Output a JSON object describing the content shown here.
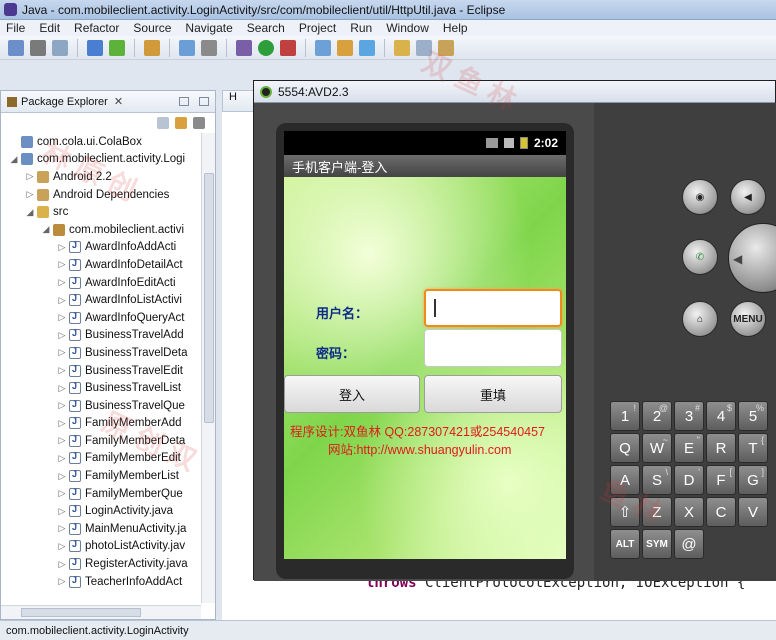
{
  "window": {
    "title": "Java - com.mobileclient.activity.LoginActivity/src/com/mobileclient/util/HttpUtil.java - Eclipse"
  },
  "menu": [
    "File",
    "Edit",
    "Refactor",
    "Source",
    "Navigate",
    "Search",
    "Project",
    "Run",
    "Window",
    "Help"
  ],
  "package_explorer": {
    "tab_label": "Package Explorer",
    "tree": [
      {
        "label": "com.cola.ui.ColaBox",
        "indent": 1,
        "icon": "project-icon"
      },
      {
        "label": "com.mobileclient.activity.Logi",
        "indent": 1,
        "icon": "project-icon",
        "expanded": true
      },
      {
        "label": "Android 2.2",
        "indent": 2,
        "icon": "library-icon"
      },
      {
        "label": "Android Dependencies",
        "indent": 2,
        "icon": "library-icon"
      },
      {
        "label": "src",
        "indent": 2,
        "icon": "source-folder-icon",
        "expanded": true
      },
      {
        "label": "com.mobileclient.activi",
        "indent": 3,
        "icon": "package-icon",
        "expanded": true
      },
      {
        "label": "AwardInfoAddActi",
        "indent": 4,
        "icon": "java-file-icon"
      },
      {
        "label": "AwardInfoDetailAct",
        "indent": 4,
        "icon": "java-file-icon"
      },
      {
        "label": "AwardInfoEditActi",
        "indent": 4,
        "icon": "java-file-icon"
      },
      {
        "label": "AwardInfoListActivi",
        "indent": 4,
        "icon": "java-file-icon"
      },
      {
        "label": "AwardInfoQueryAct",
        "indent": 4,
        "icon": "java-file-icon"
      },
      {
        "label": "BusinessTravelAdd",
        "indent": 4,
        "icon": "java-file-icon"
      },
      {
        "label": "BusinessTravelDeta",
        "indent": 4,
        "icon": "java-file-icon"
      },
      {
        "label": "BusinessTravelEdit",
        "indent": 4,
        "icon": "java-file-icon"
      },
      {
        "label": "BusinessTravelList",
        "indent": 4,
        "icon": "java-file-icon"
      },
      {
        "label": "BusinessTravelQue",
        "indent": 4,
        "icon": "java-file-icon"
      },
      {
        "label": "FamilyMemberAdd",
        "indent": 4,
        "icon": "java-file-icon"
      },
      {
        "label": "FamilyMemberDeta",
        "indent": 4,
        "icon": "java-file-icon"
      },
      {
        "label": "FamilyMemberEdit",
        "indent": 4,
        "icon": "java-file-icon"
      },
      {
        "label": "FamilyMemberList",
        "indent": 4,
        "icon": "java-file-icon"
      },
      {
        "label": "FamilyMemberQue",
        "indent": 4,
        "icon": "java-file-icon"
      },
      {
        "label": "LoginActivity.java",
        "indent": 4,
        "icon": "java-file-icon"
      },
      {
        "label": "MainMenuActivity.ja",
        "indent": 4,
        "icon": "java-file-icon"
      },
      {
        "label": "photoListActivity.jav",
        "indent": 4,
        "icon": "java-file-icon"
      },
      {
        "label": "RegisterActivity.java",
        "indent": 4,
        "icon": "java-file-icon"
      },
      {
        "label": "TeacherInfoAddAct",
        "indent": 4,
        "icon": "java-file-icon"
      }
    ]
  },
  "editor": {
    "tab_label": "H",
    "code_keyword": "throws",
    "code_rest": " ClientProtocolException, IOException {"
  },
  "status_bar": {
    "text": "com.mobileclient.activity.LoginActivity"
  },
  "emulator": {
    "title": "5554:AVD2.3",
    "clock": "2:02",
    "app_title": "手机客户端-登入",
    "username_label": "用户名：",
    "password_label": "密码：",
    "login_button": "登入",
    "reset_button": "重填",
    "credit_line": "程序设计:双鱼林    QQ:287307421或254540457",
    "website_line": "网站:http://www.shuangyulin.com",
    "menu_key": "MENU",
    "keyboard_rows": [
      [
        {
          "k": "1",
          "s": "!"
        },
        {
          "k": "2",
          "s": "@"
        },
        {
          "k": "3",
          "s": "#"
        },
        {
          "k": "4",
          "s": "$"
        },
        {
          "k": "5",
          "s": "%"
        }
      ],
      [
        {
          "k": "Q",
          "s": ""
        },
        {
          "k": "W",
          "s": "~"
        },
        {
          "k": "E",
          "s": "\""
        },
        {
          "k": "R",
          "s": ""
        },
        {
          "k": "T",
          "s": "{"
        }
      ],
      [
        {
          "k": "A",
          "s": ""
        },
        {
          "k": "S",
          "s": "\\"
        },
        {
          "k": "D",
          "s": "'"
        },
        {
          "k": "F",
          "s": "["
        },
        {
          "k": "G",
          "s": "]"
        }
      ],
      [
        {
          "k": "⇧",
          "s": ""
        },
        {
          "k": "Z",
          "s": ""
        },
        {
          "k": "X",
          "s": ""
        },
        {
          "k": "C",
          "s": ""
        },
        {
          "k": "V",
          "s": ""
        }
      ],
      [
        {
          "k": "ALT",
          "s": ""
        },
        {
          "k": "SYM",
          "s": ""
        },
        {
          "k": "@",
          "s": ""
        }
      ]
    ]
  },
  "colors": {
    "emulator_body": "#3a3a3a",
    "screen_green": "#7ed54a",
    "focus_orange": "#f08a1c",
    "credit_red": "#e01b1b",
    "label_blue": "#0b2a8a"
  }
}
